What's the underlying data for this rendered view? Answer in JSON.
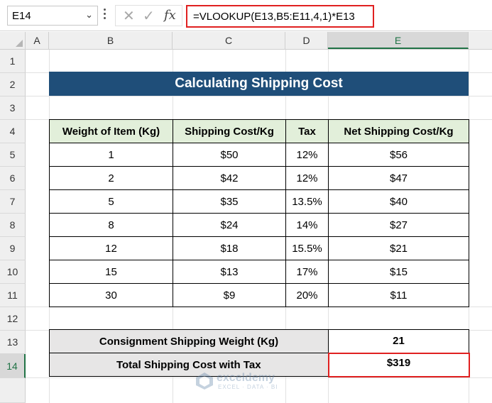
{
  "formula_bar": {
    "name_box": "E14",
    "name_box_arrow": "⌄",
    "cancel_icon": "✕",
    "enter_icon": "✓",
    "fx_label": "fx",
    "formula": "=VLOOKUP(E13,B5:E11,4,1)*E13"
  },
  "columns": [
    "A",
    "B",
    "C",
    "D",
    "E"
  ],
  "rows": [
    "1",
    "2",
    "3",
    "4",
    "5",
    "6",
    "7",
    "8",
    "9",
    "10",
    "11",
    "12",
    "13",
    "14"
  ],
  "selected_cell": "E14",
  "title": "Calculating Shipping Cost",
  "table": {
    "headers": [
      "Weight of Item (Kg)",
      "Shipping Cost/Kg",
      "Tax",
      "Net Shipping Cost/Kg"
    ],
    "rows": [
      [
        "1",
        "$50",
        "12%",
        "$56"
      ],
      [
        "2",
        "$42",
        "12%",
        "$47"
      ],
      [
        "5",
        "$35",
        "13.5%",
        "$40"
      ],
      [
        "8",
        "$24",
        "14%",
        "$27"
      ],
      [
        "12",
        "$18",
        "15.5%",
        "$21"
      ],
      [
        "15",
        "$13",
        "17%",
        "$15"
      ],
      [
        "30",
        "$9",
        "20%",
        "$11"
      ]
    ]
  },
  "summary": {
    "weight_label": "Consignment Shipping Weight (Kg)",
    "weight_value": "21",
    "total_label": "Total Shipping Cost with Tax",
    "total_value": "$319"
  },
  "watermark": {
    "name": "exceldemy",
    "tagline": "EXCEL · DATA · BI"
  },
  "colors": {
    "title_bg": "#1f4e79",
    "header_bg": "#e2efda",
    "summary_label_bg": "#e7e6e6",
    "highlight_border": "#e02020",
    "selection_green": "#217346"
  }
}
